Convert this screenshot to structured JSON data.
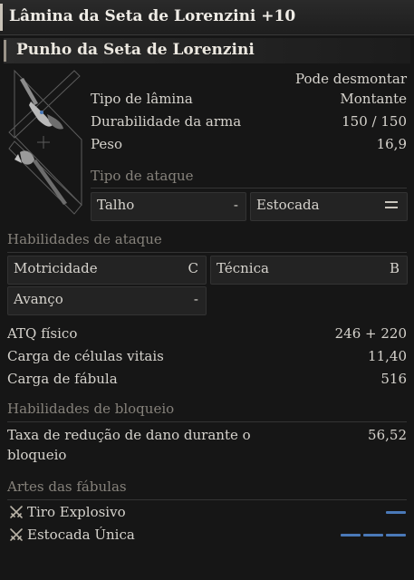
{
  "header": {
    "title": "Lâmina da Seta de Lorenzini +10",
    "subtitle": "Punho da Seta de Lorenzini"
  },
  "info": {
    "dismantle": "Pode desmontar",
    "rows": [
      {
        "label": "Tipo de lâmina",
        "value": "Montante"
      },
      {
        "label": "Durabilidade da arma",
        "value": "150 / 150"
      },
      {
        "label": "Peso",
        "value": "16,9"
      }
    ]
  },
  "attack_type": {
    "heading": "Tipo de ataque",
    "slash": {
      "label": "Talho",
      "value": "-"
    },
    "pierce": {
      "label": "Estocada",
      "icon": "double-bar-icon"
    }
  },
  "attack_abilities": {
    "heading": "Habilidades de ataque",
    "motricity": {
      "label": "Motricidade",
      "value": "C"
    },
    "technique": {
      "label": "Técnica",
      "value": "B"
    },
    "advance": {
      "label": "Avanço",
      "value": "-"
    }
  },
  "stats": [
    {
      "label": "ATQ físico",
      "value": "246 + 220"
    },
    {
      "label": "Carga de células vitais",
      "value": "11,40"
    },
    {
      "label": "Carga de fábula",
      "value": "516"
    }
  ],
  "guard": {
    "heading": "Habilidades de bloqueio",
    "label_line1": "Taxa de redução de dano durante o",
    "label_line2": "bloqueio",
    "value": "56,52"
  },
  "fable_arts": {
    "heading": "Artes das fábulas",
    "items": [
      {
        "label": "Tiro Explosivo",
        "icon": "crossed-swords-icon",
        "slots": 1
      },
      {
        "label": "Estocada Única",
        "icon": "crossed-swords-icon",
        "slots": 3
      }
    ]
  },
  "colors": {
    "slot_accent": "#4a79b8",
    "background": "#161616"
  }
}
